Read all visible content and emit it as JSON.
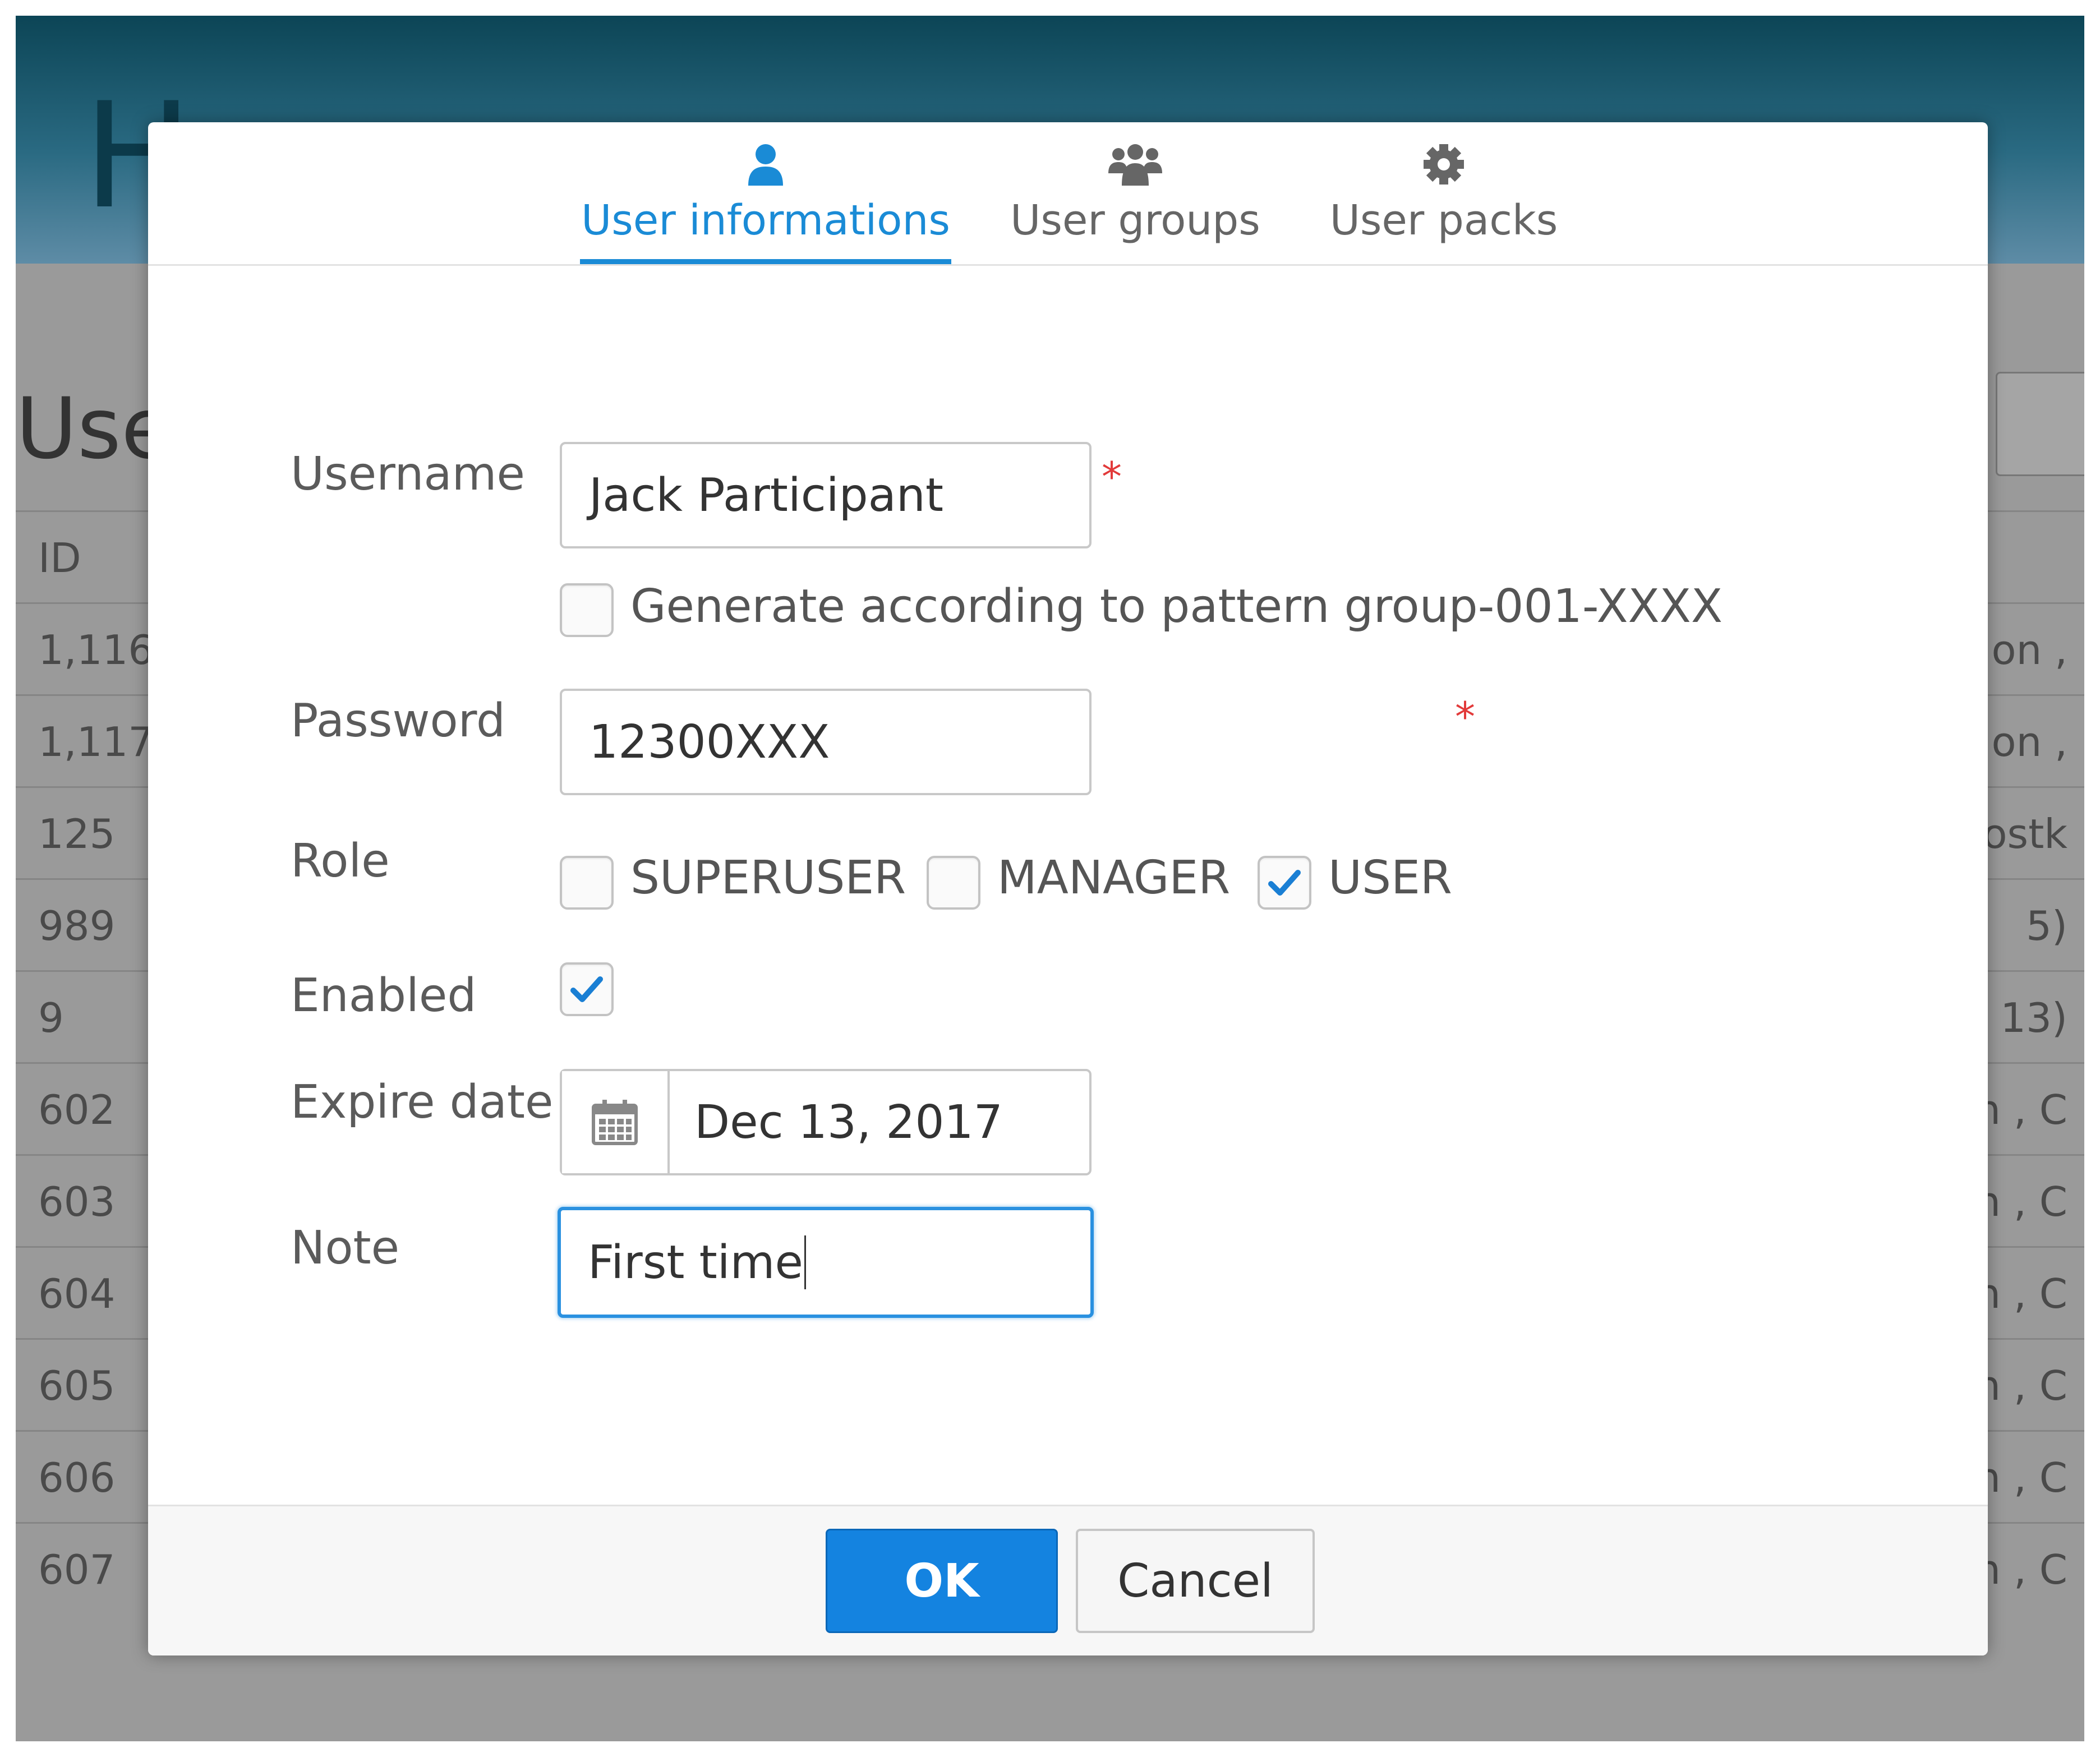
{
  "background": {
    "header_title": "H",
    "page_title": "Use",
    "table": {
      "id_header": "ID",
      "rows": [
        {
          "id": "1,116",
          "right": "rsion ,"
        },
        {
          "id": "1,117",
          "right": "rsion ,"
        },
        {
          "id": "125",
          "right": "kostk"
        },
        {
          "id": "989",
          "right": "5)"
        },
        {
          "id": "9",
          "right": "13)"
        },
        {
          "id": "602",
          "right": "on , C"
        },
        {
          "id": "603",
          "right": "on , C"
        },
        {
          "id": "604",
          "right": "on , C"
        },
        {
          "id": "605",
          "right": "on , C"
        },
        {
          "id": "606",
          "right": "on , C"
        },
        {
          "id": "607",
          "right": "on , C"
        }
      ]
    }
  },
  "dialog": {
    "tabs": [
      {
        "label": "User informations",
        "icon": "user-icon",
        "active": true
      },
      {
        "label": "User groups",
        "icon": "users-icon",
        "active": false
      },
      {
        "label": "User packs",
        "icon": "gear-icon",
        "active": false
      }
    ],
    "form": {
      "username_label": "Username",
      "username_value": "Jack Participant",
      "required_mark": "*",
      "generate_label": "Generate according to pattern group-001-XXXX",
      "generate_checked": false,
      "password_label": "Password",
      "password_value": "12300XXX",
      "role_label": "Role",
      "roles": [
        {
          "label": "SUPERUSER",
          "checked": false
        },
        {
          "label": "MANAGER",
          "checked": false
        },
        {
          "label": "USER",
          "checked": true
        }
      ],
      "enabled_label": "Enabled",
      "enabled_checked": true,
      "expire_label": "Expire date",
      "expire_value": "Dec 13, 2017",
      "note_label": "Note",
      "note_value": "First time"
    },
    "footer": {
      "ok_label": "OK",
      "cancel_label": "Cancel"
    },
    "colors": {
      "accent": "#1a8bd6",
      "required": "#e23a3a",
      "ok_button": "#1483e0"
    }
  }
}
